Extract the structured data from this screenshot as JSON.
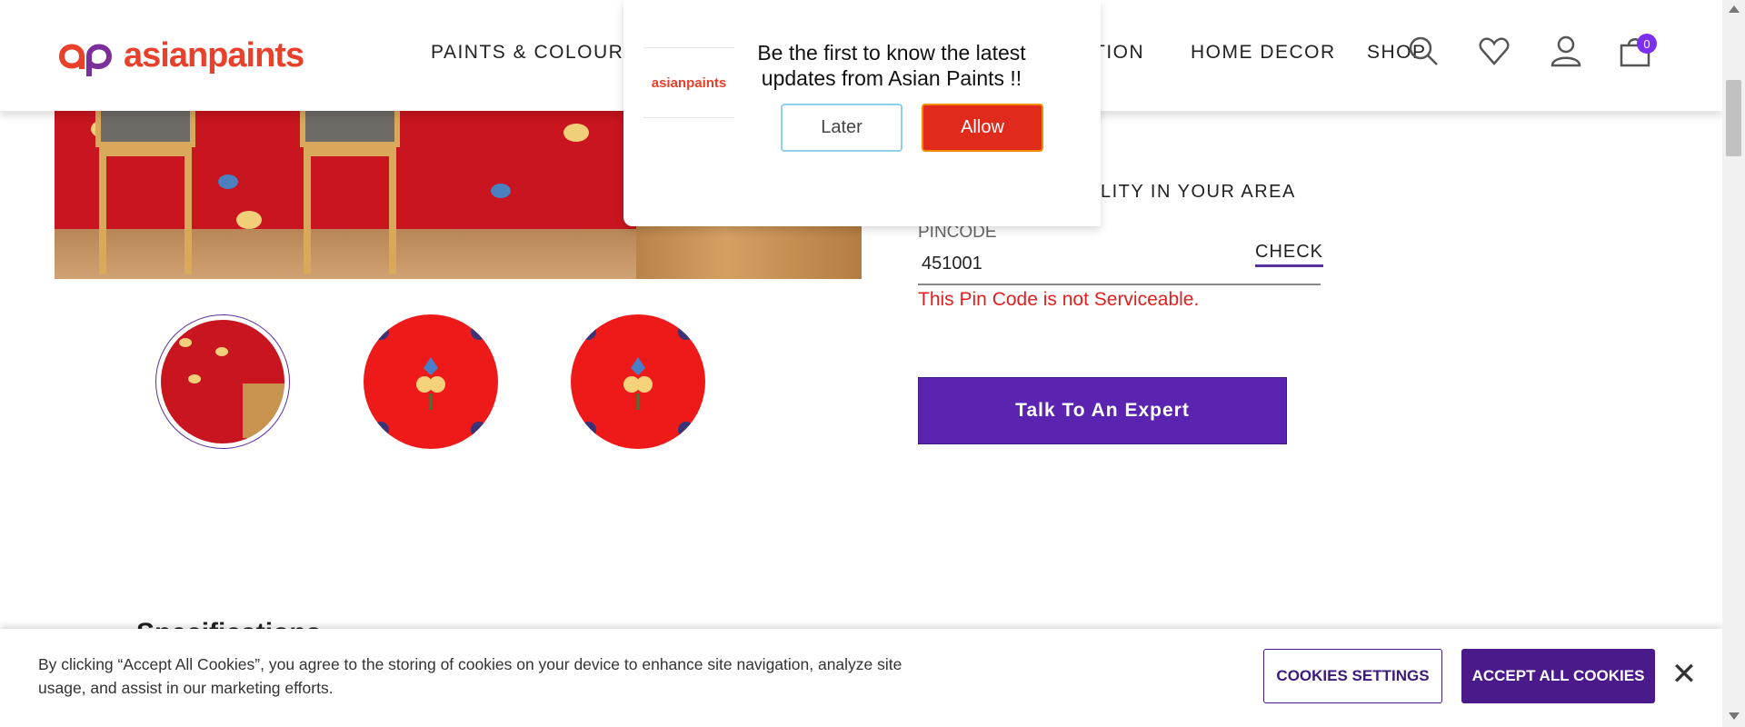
{
  "header": {
    "logo_text": "asianpaints",
    "nav": [
      "PAINTS & COLOURS",
      "TION",
      "HOME DECOR",
      "SHOP"
    ],
    "cart_count": "0",
    "icons": [
      "search-icon",
      "wishlist-heart-icon",
      "account-icon",
      "cart-bag-icon"
    ]
  },
  "notification": {
    "logo_text": "asianpaints",
    "message": "Be the first to know the latest updates from Asian Paints !!",
    "later_label": "Later",
    "allow_label": "Allow"
  },
  "product": {
    "availability_heading": "LITY IN YOUR AREA",
    "pincode_label": "PINCODE",
    "pincode_value": "451001",
    "check_label": "CHECK",
    "pincode_error": "This Pin Code is not Serviceable.",
    "expert_button": "Talk To An Expert",
    "thumbnails": [
      "room-view",
      "pattern-close-up",
      "pattern-close-up"
    ]
  },
  "specifications": {
    "title": "Specifications"
  },
  "cookie_banner": {
    "text": "By clicking “Accept All Cookies”, you agree to the storing of cookies on your device to enhance site navigation, analyze site usage, and assist in our marketing efforts.",
    "settings_label": "COOKIES SETTINGS",
    "accept_label": "ACCEPT ALL COOKIES",
    "close_label": "✕"
  },
  "colors": {
    "brand_red": "#e8402a",
    "brand_purple": "#5a24b0",
    "error_red": "#e02020",
    "wallpaper_red": "#c8151f"
  }
}
